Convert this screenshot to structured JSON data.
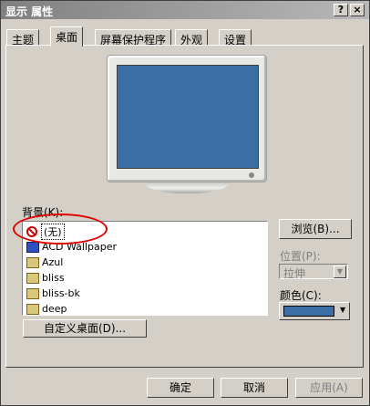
{
  "window": {
    "title": "显示 属性",
    "help_label": "?",
    "close_label": "×"
  },
  "tabs": [
    {
      "label": "主题",
      "active": false
    },
    {
      "label": "桌面",
      "active": true
    },
    {
      "label": "屏幕保护程序",
      "active": false
    },
    {
      "label": "外观",
      "active": false
    },
    {
      "label": "设置",
      "active": false
    }
  ],
  "background": {
    "label": "背景(K):",
    "items": [
      "(无)",
      "ACD Wallpaper",
      "Azul",
      "bliss",
      "bliss-bk",
      "deep"
    ],
    "selected_index": 0
  },
  "browse_label": "浏览(B)...",
  "position": {
    "label": "位置(P):",
    "value": "拉伸"
  },
  "color": {
    "label": "颜色(C):",
    "value": "#3a6ea5"
  },
  "customize_label": "自定义桌面(D)...",
  "footer": {
    "ok_label": "确定",
    "cancel_label": "取消",
    "apply_label": "应用(A)"
  },
  "colors": {
    "screen": "#3a6ea5",
    "annotation": "#e00000"
  }
}
